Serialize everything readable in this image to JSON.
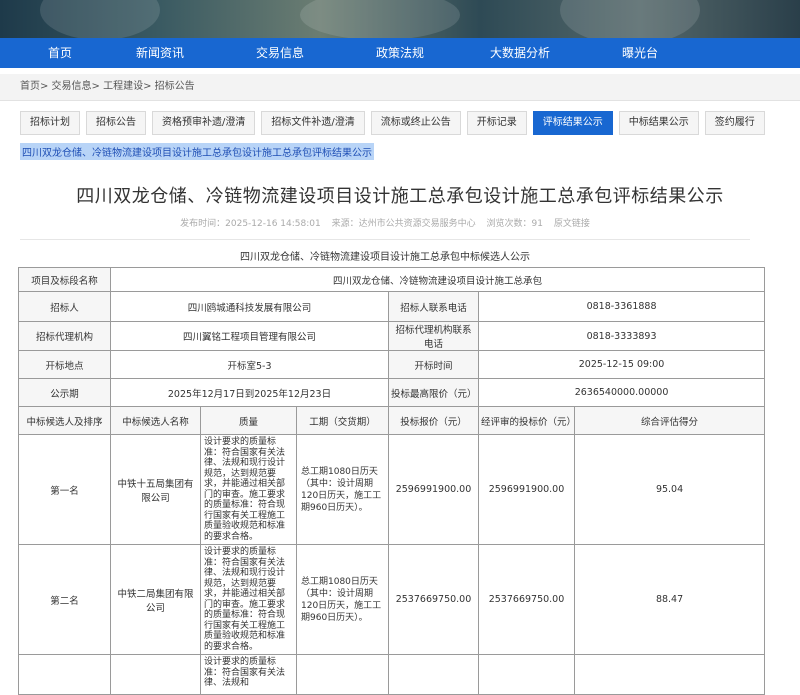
{
  "nav": [
    "首页",
    "新闻资讯",
    "交易信息",
    "政策法规",
    "大数据分析",
    "曝光台"
  ],
  "breadcrumb": "首页> 交易信息> 工程建设> 招标公告",
  "tabs": [
    {
      "label": "招标计划",
      "active": false
    },
    {
      "label": "招标公告",
      "active": false
    },
    {
      "label": "资格预审补遗/澄清",
      "active": false
    },
    {
      "label": "招标文件补遗/澄清",
      "active": false
    },
    {
      "label": "流标或终止公告",
      "active": false
    },
    {
      "label": "开标记录",
      "active": false
    },
    {
      "label": "评标结果公示",
      "active": true
    },
    {
      "label": "中标结果公示",
      "active": false
    },
    {
      "label": "签约履行",
      "active": false
    }
  ],
  "highlight_link": "四川双龙仓储、冷链物流建设项目设计施工总承包设计施工总承包评标结果公示",
  "title": "四川双龙仓储、冷链物流建设项目设计施工总承包设计施工总承包评标结果公示",
  "meta": {
    "publish_time": "发布时间：2025-12-16 14:58:01",
    "source": "来源：达州市公共资源交易服务中心",
    "views": "浏览次数：91",
    "original_link": "原文链接"
  },
  "table_subtitle": "四川双龙仓储、冷链物流建设项目设计施工总承包中标候选人公示",
  "info": {
    "project_label": "项目及标段名称",
    "project_value": "四川双龙仓储、冷链物流建设项目设计施工总承包",
    "tenderer_label": "招标人",
    "tenderer_value": "四川鸥城通科技发展有限公司",
    "tenderer_phone_label": "招标人联系电话",
    "tenderer_phone_value": "0818-3361888",
    "agent_label": "招标代理机构",
    "agent_value": "四川翼铭工程项目管理有限公司",
    "agent_phone_label": "招标代理机构联系电话",
    "agent_phone_value": "0818-3333893",
    "location_label": "开标地点",
    "location_value": "开标室5-3",
    "time_label": "开标时间",
    "time_value": "2025-12-15 09:00",
    "period_label": "公示期",
    "period_value": "2025年12月17日到2025年12月23日",
    "cap_label": "投标最高限价（元）",
    "cap_value": "2636540000.00000"
  },
  "headers": [
    "中标候选人及排序",
    "中标候选人名称",
    "质量",
    "工期（交货期）",
    "投标报价（元）",
    "经评审的投标价（元）",
    "综合评估得分"
  ],
  "candidates": [
    {
      "rank": "第一名",
      "name": "中铁十五局集团有限公司",
      "quality": "设计要求的质量标准：符合国家有关法律、法规和现行设计规范，达到规范要求，并能通过相关部门的审查。施工要求的质量标准：符合现行国家有关工程施工质量验收规范和标准的要求合格。",
      "duration": "总工期1080日历天（其中：设计周期120日历天，施工工期960日历天）。",
      "bid": "2596991900.00",
      "evaluated": "2596991900.00",
      "score": "95.04"
    },
    {
      "rank": "第二名",
      "name": "中铁二局集团有限公司",
      "quality": "设计要求的质量标准：符合国家有关法律、法规和现行设计规范，达到规范要求，并能通过相关部门的审查。施工要求的质量标准：符合现行国家有关工程施工质量验收规范和标准的要求合格。",
      "duration": "总工期1080日历天（其中：设计周期120日历天，施工工期960日历天）。",
      "bid": "2537669750.00",
      "evaluated": "2537669750.00",
      "score": "88.47"
    },
    {
      "rank": "",
      "name": "",
      "quality": "设计要求的质量标准：符合国家有关法律、法规和",
      "duration": "",
      "bid": "",
      "evaluated": "",
      "score": ""
    }
  ]
}
